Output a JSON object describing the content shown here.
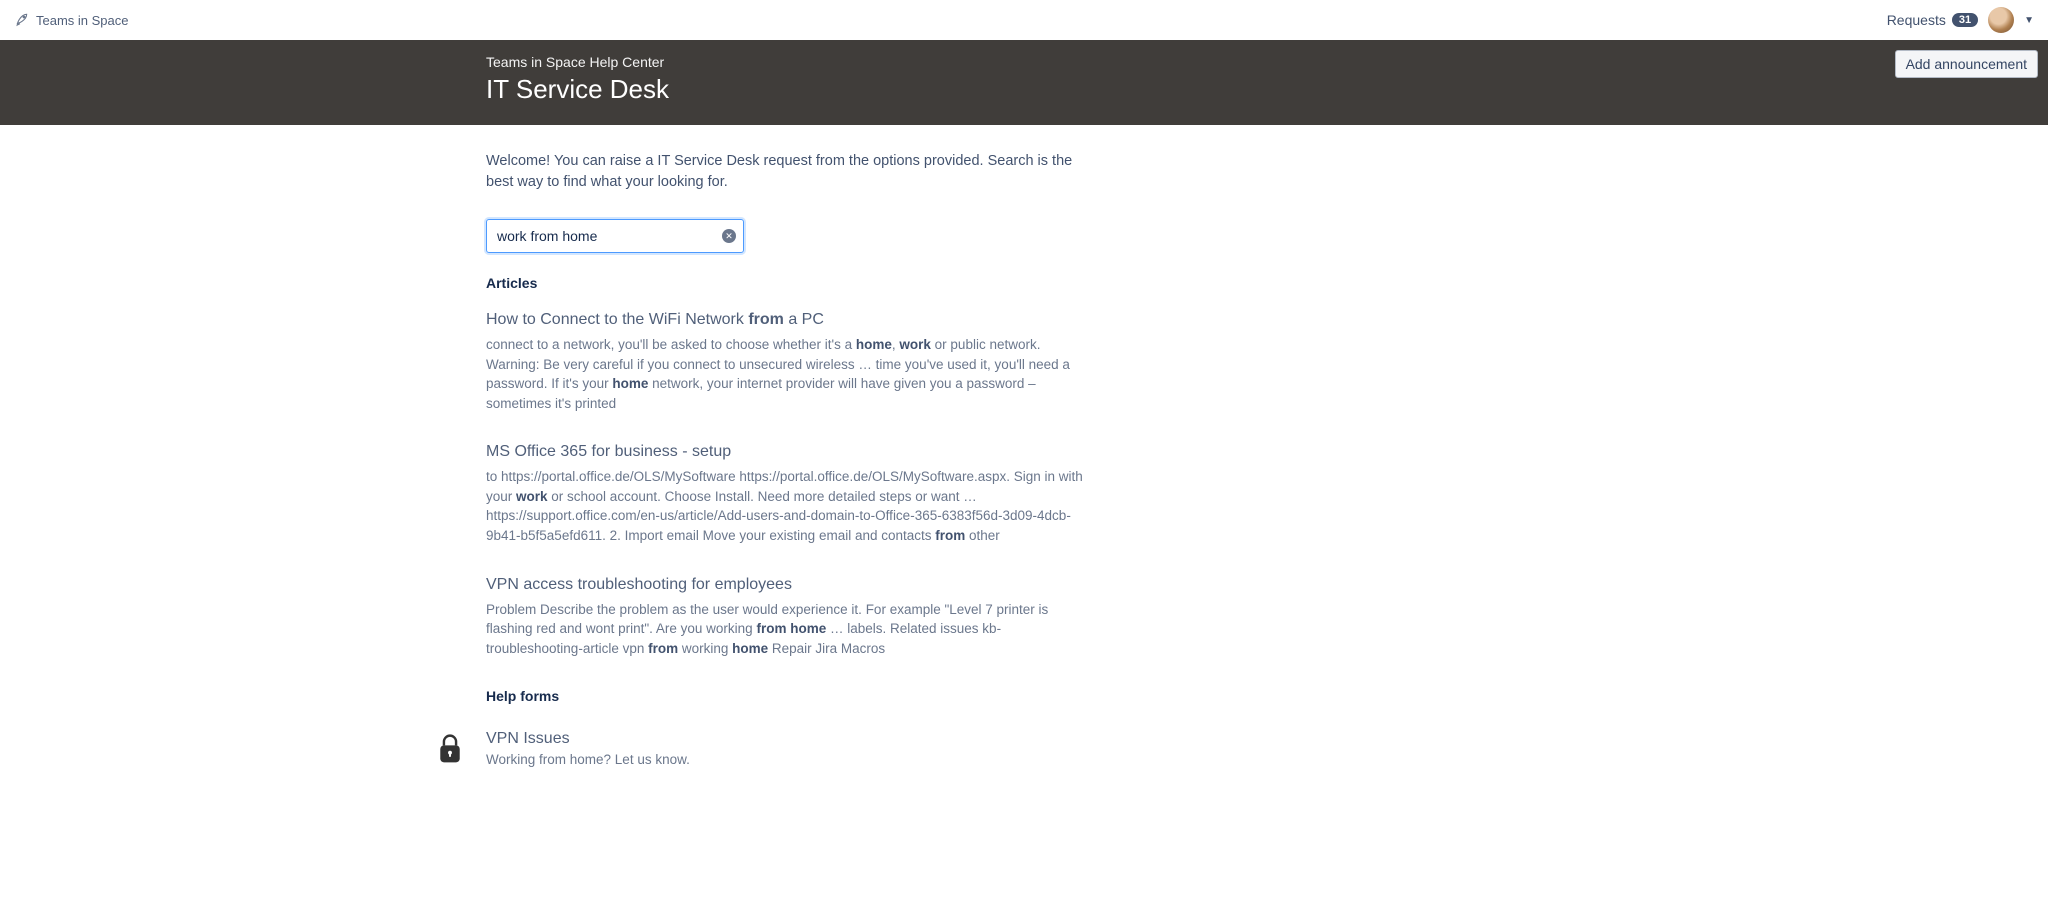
{
  "topbar": {
    "brand": "Teams in Space",
    "requests_label": "Requests",
    "requests_count": "31"
  },
  "hero": {
    "breadcrumb": "Teams in Space Help Center",
    "title": "IT Service Desk",
    "announce_label": "Add announcement"
  },
  "intro": "Welcome! You can raise a IT Service Desk request from the options provided. Search is the best way to find what your looking for.",
  "search": {
    "value": "work from home"
  },
  "articles_heading": "Articles",
  "help_forms_heading": "Help forms",
  "articles": [
    {
      "title_pre": "How to Connect to the WiFi Network ",
      "title_b1": "from",
      "title_post": " a PC",
      "s1": "connect to a network, you'll be asked to choose whether it's a ",
      "b1": "home",
      "s2": ", ",
      "b2": "work",
      "s3": " or public network.   Warning: Be very careful if you connect to unsecured wireless … time you've used it, you'll need a password. If it's your ",
      "b3": "home",
      "s4": " network, your internet provider will have given you a password – sometimes it's printed"
    },
    {
      "title": "MS Office 365 for business - setup",
      "s1": "to https://portal.office.de/OLS/MySoftware https://portal.office.de/OLS/MySoftware.aspx. Sign in with your ",
      "b1": "work",
      "s2": " or school account. Choose Install. Need more detailed steps or want … https://support.office.com/en-us/article/Add-users-and-domain-to-Office-365-6383f56d-3d09-4dcb-9b41-b5f5a5efd611. 2. Import email Move your existing email and contacts ",
      "b2": "from",
      "s3": " other"
    },
    {
      "title": "VPN access troubleshooting for employees",
      "s1": "Problem Describe the problem as the user would experience it. For example \"Level 7 printer is flashing red and wont print\". Are you working ",
      "b1": "from",
      "s2": " ",
      "b2": "home",
      "s3": " … labels. Related issues kb-troubleshooting-article vpn ",
      "b3": "from",
      "s4": " working ",
      "b4": "home",
      "s5": " Repair Jira Macros"
    }
  ],
  "forms": [
    {
      "title": "VPN Issues",
      "desc": "Working from home? Let us know."
    }
  ]
}
